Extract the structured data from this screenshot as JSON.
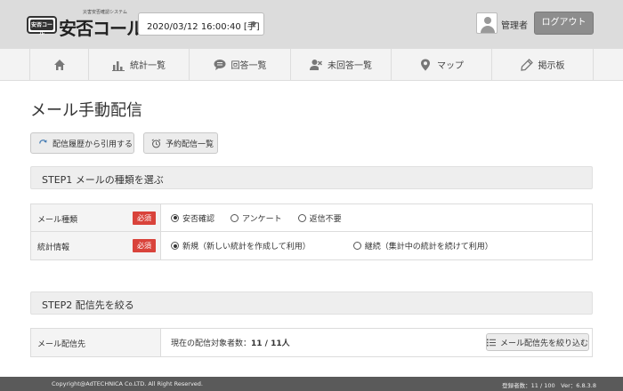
{
  "header": {
    "logo_subtitle": "災害安否確認システム",
    "logo_badge": "安否コール",
    "logo_text": "安否コール",
    "datetime_select": "2020/03/12 16:00:40 [手]",
    "user_name": "管理者",
    "logout_label": "ログアウト"
  },
  "nav": {
    "items": [
      {
        "label": "",
        "icon": "home-icon"
      },
      {
        "label": "統計一覧",
        "icon": "bar-chart-icon"
      },
      {
        "label": "回答一覧",
        "icon": "chat-bubble-icon"
      },
      {
        "label": "未回答一覧",
        "icon": "user-x-icon"
      },
      {
        "label": "マップ",
        "icon": "map-pin-icon"
      },
      {
        "label": "掲示板",
        "icon": "pencil-icon"
      }
    ]
  },
  "page": {
    "title": "メール手動配信",
    "buttons": {
      "history": "配信履歴から引用する",
      "scheduled": "予約配信一覧"
    }
  },
  "step1": {
    "title": "STEP1 メールの種類を選ぶ",
    "rows": [
      {
        "label": "メール種類",
        "required": "必須",
        "options": [
          {
            "label": "安否確認",
            "checked": true
          },
          {
            "label": "アンケート",
            "checked": false
          },
          {
            "label": "返信不要",
            "checked": false
          }
        ]
      },
      {
        "label": "統計情報",
        "required": "必須",
        "options": [
          {
            "label": "新規（新しい統計を作成して利用）",
            "checked": true
          },
          {
            "label": "継続（集計中の統計を続けて利用）",
            "checked": false
          }
        ]
      }
    ]
  },
  "step2": {
    "title": "STEP2 配信先を絞る",
    "row": {
      "label": "メール配信先",
      "count_prefix": "現在の配信対象者数：",
      "count_value": "11 / 11人",
      "narrow_button": "メール配信先を絞り込む"
    }
  },
  "footer": {
    "copyright": "Copyright@AdTECHNICA Co.LTD. All Right Reserved.",
    "status": "登録者数：11 / 100　Ver：6.8.3.8"
  }
}
